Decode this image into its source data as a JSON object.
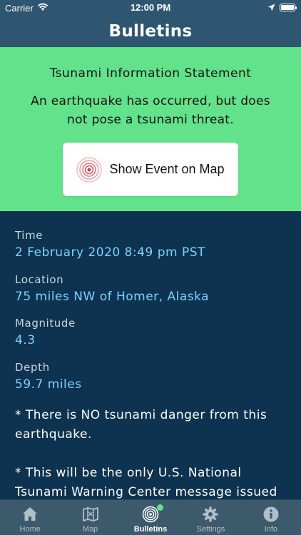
{
  "status_bar": {
    "carrier": "Carrier",
    "time": "12:00 PM"
  },
  "nav": {
    "title": "Bulletins"
  },
  "bulletin": {
    "heading": "Tsunami Information Statement",
    "message": "An earthquake has occurred, but does not pose a tsunami threat.",
    "show_event_label": "Show Event on Map",
    "background_color": "#62e28a"
  },
  "details": {
    "time_label": "Time",
    "time_value": "2 February 2020 8:49 pm PST",
    "location_label": "Location",
    "location_value": "75 miles NW of Homer, Alaska",
    "magnitude_label": "Magnitude",
    "magnitude_value": "4.3",
    "depth_label": "Depth",
    "depth_value": "59.7 miles",
    "notes": [
      "* There is NO tsunami danger from this earthquake.",
      "* This will be the only U.S. National Tsunami Warning Center message issued"
    ]
  },
  "tabs": [
    {
      "label": "Home",
      "icon": "home-icon",
      "active": false
    },
    {
      "label": "Map",
      "icon": "map-icon",
      "active": false
    },
    {
      "label": "Bulletins",
      "icon": "bulletins-icon",
      "active": true
    },
    {
      "label": "Settings",
      "icon": "gear-icon",
      "active": false
    },
    {
      "label": "Info",
      "icon": "info-icon",
      "active": false
    }
  ],
  "colors": {
    "accent": "#62e28a",
    "link": "#7fd0ff",
    "background": "#0d3350",
    "bar": "#2f5670"
  }
}
